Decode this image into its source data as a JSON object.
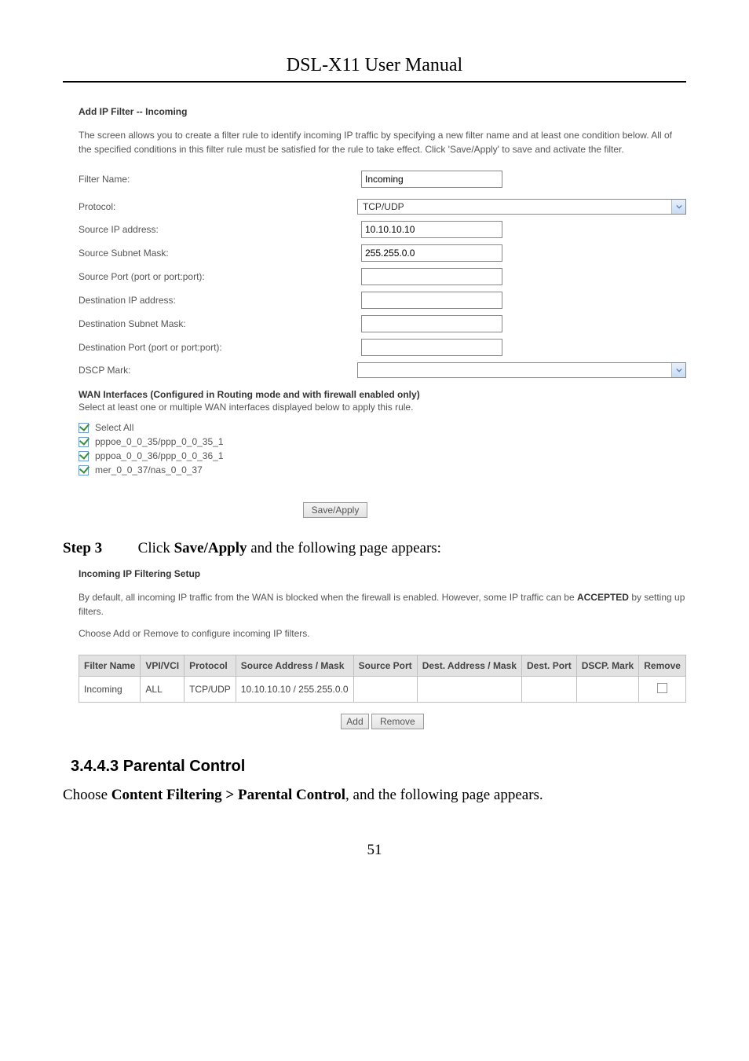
{
  "doc": {
    "title": "DSL-X11 User Manual",
    "page_number": "51"
  },
  "filter_form": {
    "heading": "Add IP Filter -- Incoming",
    "description": "The screen allows you to create a filter rule to identify incoming IP traffic by specifying a new filter name and at least one condition below. All of the specified conditions in this filter rule must be satisfied for the rule to take effect. Click 'Save/Apply' to save and activate the filter.",
    "labels": {
      "filter_name": "Filter Name:",
      "protocol": "Protocol:",
      "source_ip": "Source IP address:",
      "source_mask": "Source Subnet Mask:",
      "source_port": "Source Port (port or port:port):",
      "dest_ip": "Destination IP address:",
      "dest_mask": "Destination Subnet Mask:",
      "dest_port": "Destination Port (port or port:port):",
      "dscp": "DSCP Mark:"
    },
    "values": {
      "filter_name": "Incoming",
      "protocol": "TCP/UDP",
      "source_ip": "10.10.10.10",
      "source_mask": "255.255.0.0",
      "source_port": "",
      "dest_ip": "",
      "dest_mask": "",
      "dest_port": "",
      "dscp": ""
    },
    "wan_heading": "WAN Interfaces (Configured in Routing mode and with firewall enabled only)",
    "wan_desc": "Select at least one or multiple WAN interfaces displayed below to apply this rule.",
    "checkboxes": {
      "select_all": "Select All",
      "if1": "pppoe_0_0_35/ppp_0_0_35_1",
      "if2": "pppoa_0_0_36/ppp_0_0_36_1",
      "if3": "mer_0_0_37/nas_0_0_37"
    },
    "save_apply": "Save/Apply"
  },
  "step3": {
    "prefix": "Step 3",
    "text_before": "Click ",
    "bold": "Save/Apply",
    "text_after": " and the following page appears:"
  },
  "setup": {
    "heading": "Incoming IP Filtering Setup",
    "desc_before": "By default, all incoming IP traffic from the WAN is blocked when the firewall is enabled. However, some IP traffic can be ",
    "desc_bold": "ACCEPTED",
    "desc_after": " by setting up filters.",
    "choose": "Choose Add or Remove to configure incoming IP filters.",
    "headers": {
      "filter_name": "Filter Name",
      "vpivci": "VPI/VCI",
      "protocol": "Protocol",
      "source_addr": "Source Address / Mask",
      "source_port": "Source Port",
      "dest_addr": "Dest. Address / Mask",
      "dest_port": "Dest. Port",
      "dscp": "DSCP. Mark",
      "remove": "Remove"
    },
    "row": {
      "filter_name": "Incoming",
      "vpivci": "ALL",
      "protocol": "TCP/UDP",
      "source_addr": "10.10.10.10 / 255.255.0.0",
      "source_port": "",
      "dest_addr": "",
      "dest_port": "",
      "dscp": ""
    },
    "add_btn": "Add",
    "remove_btn": "Remove"
  },
  "section": {
    "number_title": "3.4.4.3  Parental Control",
    "body_before": "Choose ",
    "body_bold": "Content Filtering > Parental Control",
    "body_after": ", and the following page appears."
  }
}
